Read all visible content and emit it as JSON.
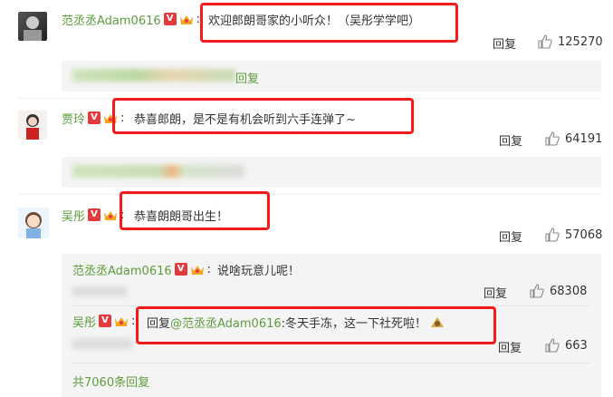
{
  "comments": [
    {
      "user": "范丞丞Adam0616",
      "text": "欢迎郎朗哥家的小听众！（吴彤学学吧）",
      "reply_label": "回复",
      "likes": "125270",
      "reply_preview": "回复"
    },
    {
      "user": "贾玲",
      "text": "恭喜郎朗，是不是有机会听到六手连弹了~",
      "reply_label": "回复",
      "likes": "64191"
    },
    {
      "user": "吴彤",
      "text": "恭喜朗朗哥出生！",
      "reply_label": "回复",
      "likes": "57068"
    }
  ],
  "replies": [
    {
      "user": "范丞丞Adam0616",
      "text": "说啥玩意儿呢！",
      "reply_label": "回复",
      "likes": "68308"
    },
    {
      "user": "吴彤",
      "prefix": "回复",
      "mention": "@范丞丞Adam0616",
      "text": ":冬天手冻，这一下社死啦！",
      "reply_label": "回复",
      "likes": "663"
    }
  ],
  "more_replies": "共7060条回复",
  "colors": {
    "highlight": "#f21a1a",
    "username": "#eb7350",
    "reply_username": "#5d9c3c",
    "subbox": "#f4f4f4"
  }
}
